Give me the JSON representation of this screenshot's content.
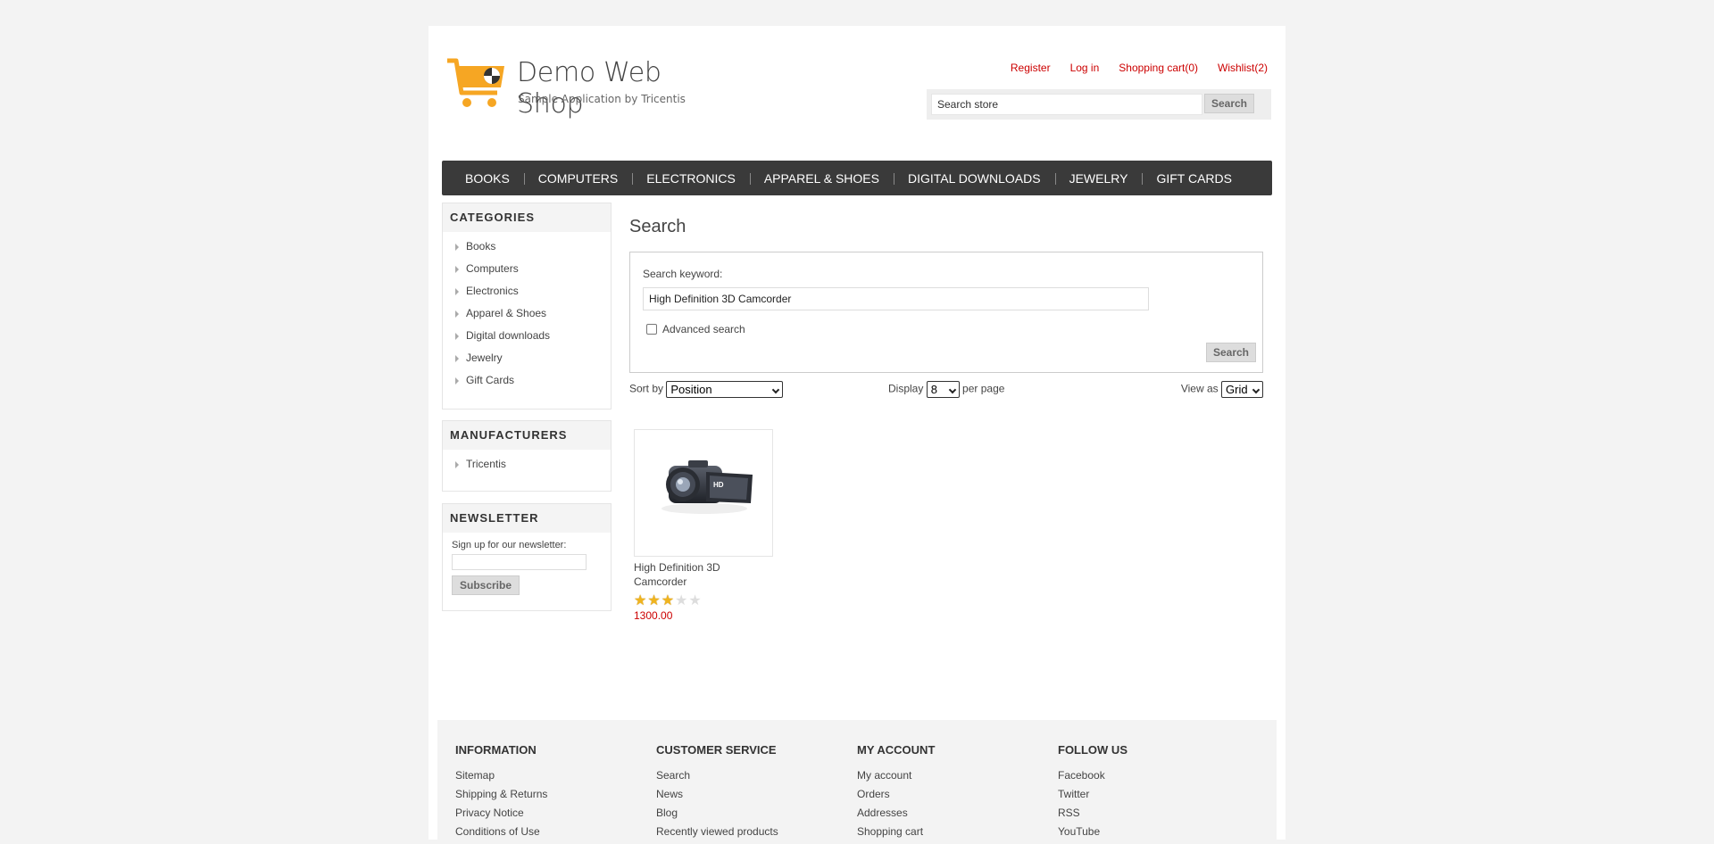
{
  "header": {
    "title": "Demo Web Shop",
    "subtitle": "Sample Application by Tricentis",
    "links": [
      "Register",
      "Log in",
      "Shopping cart(0)",
      "Wishlist(2)"
    ]
  },
  "search_store": {
    "value": "Search store",
    "button": "Search"
  },
  "top_menu": [
    "Books",
    "Computers",
    "Electronics",
    "Apparel & Shoes",
    "Digital downloads",
    "Jewelry",
    "Gift Cards"
  ],
  "sidebar": {
    "categories": {
      "title": "Categories",
      "items": [
        "Books",
        "Computers",
        "Electronics",
        "Apparel & Shoes",
        "Digital downloads",
        "Jewelry",
        "Gift Cards"
      ]
    },
    "manufacturers": {
      "title": "Manufacturers",
      "items": [
        "Tricentis"
      ]
    },
    "newsletter": {
      "title": "Newsletter",
      "label": "Sign up for our newsletter:",
      "button": "Subscribe"
    }
  },
  "main": {
    "title": "Search",
    "keyword_label": "Search keyword:",
    "keyword_value": "High Definition 3D Camcorder",
    "advanced_label": "Advanced search",
    "advanced_checked": false,
    "search_button": "Search",
    "sort_label": "Sort by",
    "sort_value": "Position",
    "display_label": "Display",
    "display_value": "8",
    "per_page": "per page",
    "view_label": "View as",
    "view_value": "Grid"
  },
  "products": [
    {
      "title": "High Definition 3D Camcorder",
      "rating": 3,
      "rating_max": 5,
      "price": "1300.00",
      "image_icon": "camcorder-image"
    }
  ],
  "footer": {
    "columns": [
      {
        "title": "Information",
        "links": [
          "Sitemap",
          "Shipping & Returns",
          "Privacy Notice",
          "Conditions of Use"
        ]
      },
      {
        "title": "Customer service",
        "links": [
          "Search",
          "News",
          "Blog",
          "Recently viewed products"
        ]
      },
      {
        "title": "My account",
        "links": [
          "My account",
          "Orders",
          "Addresses",
          "Shopping cart"
        ]
      },
      {
        "title": "Follow us",
        "links": [
          "Facebook",
          "Twitter",
          "RSS",
          "YouTube"
        ]
      }
    ]
  },
  "colors": {
    "accent_red": "#cc0000",
    "menu_bg": "#3a3a3a",
    "star": "#f0b41e",
    "logo_cart": "#f6a623"
  }
}
